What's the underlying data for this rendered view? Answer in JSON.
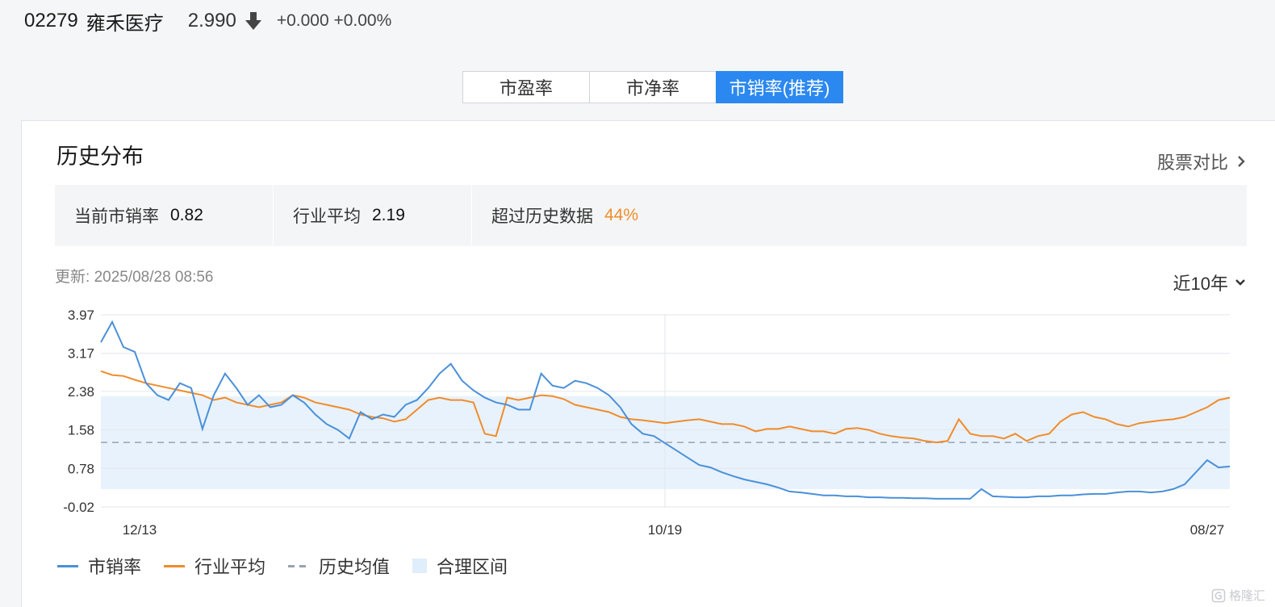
{
  "quote": {
    "code": "02279",
    "name": "雍禾医疗",
    "price": "2.990",
    "change": "+0.000 +0.00%",
    "arrow_icon": "arrow-down-icon"
  },
  "tabs": [
    {
      "label": "市盈率",
      "active": false
    },
    {
      "label": "市净率",
      "active": false
    },
    {
      "label": "市销率(推荐)",
      "active": true
    }
  ],
  "panel": {
    "title": "历史分布",
    "compare_link": "股票对比",
    "stats": [
      {
        "label": "当前市销率",
        "value": "0.82"
      },
      {
        "label": "行业平均",
        "value": "2.19"
      },
      {
        "label": "超过历史数据",
        "value": "44%"
      }
    ],
    "update_label": "更新:",
    "update_time": "2025/08/28 08:56",
    "range": "近10年"
  },
  "legend": {
    "ps": "市销率",
    "industry": "行业平均",
    "hist_mean": "历史均值",
    "fair_range": "合理区间"
  },
  "watermark": "格隆汇",
  "colors": {
    "accent": "#2b88f0",
    "ps_line": "#4a90d9",
    "industry_line": "#f08c2b",
    "mean_line": "#9aa3ad",
    "band": "#e8f2fc",
    "highlight": "#f08c2b"
  },
  "chart_data": {
    "type": "line",
    "y_ticks": [
      "3.97",
      "3.17",
      "2.38",
      "1.58",
      "0.78",
      "-0.02"
    ],
    "ylim": [
      -0.02,
      3.97
    ],
    "x_ticks": [
      "12/13",
      "10/19",
      "08/27"
    ],
    "hist_mean": 1.32,
    "fair_range": [
      0.35,
      2.28
    ],
    "grid": true,
    "series": [
      {
        "name": "市销率",
        "color": "#4a90d9",
        "values": [
          3.4,
          3.82,
          3.3,
          3.2,
          2.55,
          2.3,
          2.2,
          2.55,
          2.45,
          1.6,
          2.3,
          2.75,
          2.45,
          2.1,
          2.3,
          2.05,
          2.1,
          2.3,
          2.15,
          1.9,
          1.7,
          1.58,
          1.4,
          1.95,
          1.8,
          1.9,
          1.85,
          2.1,
          2.2,
          2.45,
          2.75,
          2.95,
          2.6,
          2.4,
          2.25,
          2.15,
          2.1,
          2.0,
          2.0,
          2.75,
          2.5,
          2.45,
          2.6,
          2.55,
          2.45,
          2.3,
          2.05,
          1.7,
          1.5,
          1.45,
          1.3,
          1.15,
          1.0,
          0.85,
          0.8,
          0.7,
          0.62,
          0.55,
          0.5,
          0.45,
          0.38,
          0.3,
          0.28,
          0.25,
          0.22,
          0.22,
          0.2,
          0.2,
          0.18,
          0.18,
          0.17,
          0.17,
          0.16,
          0.16,
          0.15,
          0.15,
          0.15,
          0.15,
          0.35,
          0.2,
          0.19,
          0.18,
          0.18,
          0.2,
          0.2,
          0.22,
          0.22,
          0.24,
          0.25,
          0.25,
          0.28,
          0.3,
          0.3,
          0.28,
          0.3,
          0.35,
          0.45,
          0.7,
          0.95,
          0.8,
          0.82
        ]
      },
      {
        "name": "行业平均",
        "color": "#f08c2b",
        "values": [
          2.8,
          2.72,
          2.7,
          2.62,
          2.55,
          2.5,
          2.45,
          2.4,
          2.35,
          2.3,
          2.2,
          2.25,
          2.15,
          2.1,
          2.05,
          2.1,
          2.15,
          2.3,
          2.25,
          2.15,
          2.1,
          2.05,
          2.0,
          1.9,
          1.85,
          1.82,
          1.75,
          1.8,
          2.0,
          2.2,
          2.25,
          2.2,
          2.2,
          2.15,
          1.5,
          1.45,
          2.25,
          2.2,
          2.25,
          2.3,
          2.28,
          2.22,
          2.1,
          2.05,
          2.0,
          1.95,
          1.85,
          1.8,
          1.78,
          1.75,
          1.72,
          1.75,
          1.78,
          1.8,
          1.75,
          1.7,
          1.7,
          1.65,
          1.55,
          1.6,
          1.6,
          1.65,
          1.6,
          1.55,
          1.55,
          1.5,
          1.6,
          1.62,
          1.58,
          1.5,
          1.45,
          1.42,
          1.4,
          1.35,
          1.32,
          1.35,
          1.8,
          1.5,
          1.45,
          1.45,
          1.4,
          1.5,
          1.35,
          1.45,
          1.5,
          1.75,
          1.9,
          1.95,
          1.85,
          1.8,
          1.7,
          1.65,
          1.72,
          1.75,
          1.78,
          1.8,
          1.85,
          1.95,
          2.05,
          2.2,
          2.25
        ]
      }
    ]
  }
}
